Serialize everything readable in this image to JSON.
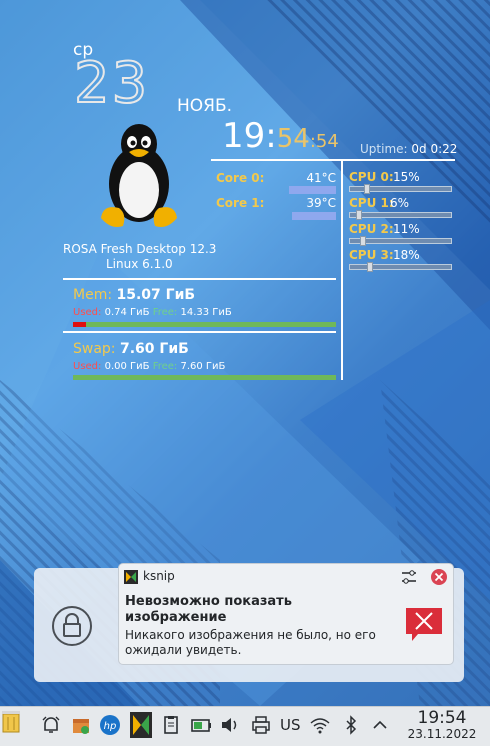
{
  "widget": {
    "weekday": "ср",
    "day": "23",
    "month": "НОЯБ.",
    "time_h": "19:",
    "time_m": "54",
    "time_s": ":54",
    "uptime_label": "Uptime:",
    "uptime_value": "0d 0:22",
    "os_name": "ROSA Fresh Desktop 12.3",
    "kernel": "Linux 6.1.0"
  },
  "temps": [
    {
      "label": "Core 0:",
      "value": "41°C"
    },
    {
      "label": "Core 1:",
      "value": "39°C"
    }
  ],
  "cpus": [
    {
      "label": "CPU 0:",
      "value": "15%",
      "level": 0.15
    },
    {
      "label": "CPU 1:",
      "value": "6%",
      "level": 0.06
    },
    {
      "label": "CPU 2:",
      "value": "11%",
      "level": 0.11
    },
    {
      "label": "CPU 3:",
      "value": "18%",
      "level": 0.18
    }
  ],
  "mem": {
    "label": "Mem:",
    "total": "15.07 ГиБ",
    "used_label": "Used:",
    "used": "0.74 ГиБ",
    "free_label": "Free:",
    "free": "14.33 ГиБ",
    "used_fraction": 0.05
  },
  "swap": {
    "label": "Swap:",
    "total": "7.60 ГиБ",
    "used_label": "Used:",
    "used": "0.00 ГиБ",
    "free_label": "Free:",
    "free": "7.60 ГиБ",
    "used_fraction": 0.0
  },
  "notification": {
    "app": "ksnip",
    "title": "Невозможно показать изображение",
    "body": "Никакого изображения не было, но его ожидали увидеть."
  },
  "taskbar": {
    "layout": "US",
    "time": "19:54",
    "date": "23.11.2022",
    "icons": [
      "trash-icon",
      "notifications-icon",
      "package-icon",
      "hp-icon",
      "ksnip-icon",
      "clipboard-icon",
      "battery-icon",
      "volume-icon",
      "printer-icon",
      "wifi-icon",
      "bluetooth-icon",
      "chevron-up-icon"
    ]
  },
  "colors": {
    "accent": "#f2c94c",
    "temp_bar": "#8fa8ee",
    "mem_bar": "#6fb85a",
    "used": "#e01010"
  }
}
